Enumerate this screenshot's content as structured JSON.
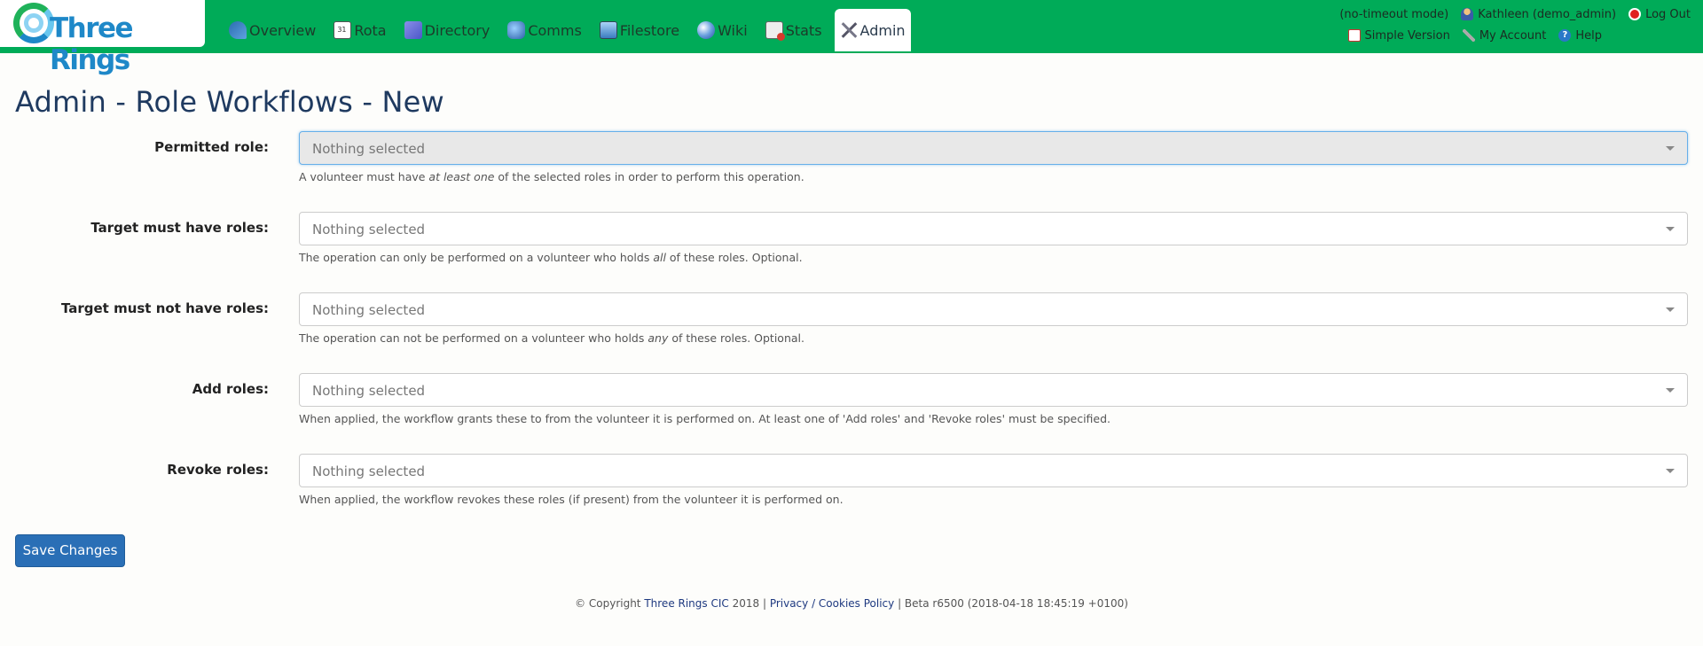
{
  "brand": {
    "name": "Three Rings"
  },
  "nav": [
    {
      "label": "Overview",
      "icon": "overview-icon"
    },
    {
      "label": "Rota",
      "icon": "calendar-icon"
    },
    {
      "label": "Directory",
      "icon": "directory-icon"
    },
    {
      "label": "Comms",
      "icon": "comms-icon"
    },
    {
      "label": "Filestore",
      "icon": "filestore-icon"
    },
    {
      "label": "Wiki",
      "icon": "wiki-globe-icon"
    },
    {
      "label": "Stats",
      "icon": "stats-icon"
    },
    {
      "label": "Admin",
      "icon": "tools-icon",
      "active": true
    }
  ],
  "topright": {
    "mode": "(no-timeout mode)",
    "user": "Kathleen (demo_admin)",
    "logout": "Log Out",
    "simple": "Simple Version",
    "account": "My Account",
    "help": "Help"
  },
  "page": {
    "title": "Admin - Role Workflows - New"
  },
  "form": {
    "placeholder": "Nothing selected",
    "fields": [
      {
        "label": "Permitted role:",
        "value": "Nothing selected",
        "help_pre": "A volunteer must have ",
        "help_em": "at least one",
        "help_post": " of the selected roles in order to perform this operation."
      },
      {
        "label": "Target must have roles:",
        "value": "Nothing selected",
        "help_pre": "The operation can only be performed on a volunteer who holds ",
        "help_em": "all",
        "help_post": " of these roles. Optional."
      },
      {
        "label": "Target must not have roles:",
        "value": "Nothing selected",
        "help_pre": "The operation can not be performed on a volunteer who holds ",
        "help_em": "any",
        "help_post": " of these roles. Optional."
      },
      {
        "label": "Add roles:",
        "value": "Nothing selected",
        "help_pre": "When applied, the workflow grants these to from the volunteer it is performed on. At least one of 'Add roles' and 'Revoke roles' must be specified.",
        "help_em": "",
        "help_post": ""
      },
      {
        "label": "Revoke roles:",
        "value": "Nothing selected",
        "help_pre": "When applied, the workflow revokes these roles (if present) from the volunteer it is performed on.",
        "help_em": "",
        "help_post": ""
      }
    ],
    "save_label": "Save Changes"
  },
  "footer": {
    "copyright": "© Copyright ",
    "org": "Three Rings CIC",
    "year": " 2018 | ",
    "privacy": "Privacy / Cookies Policy",
    "version": " | Beta r6500 (2018-04-18 18:45:19 +0100)"
  }
}
